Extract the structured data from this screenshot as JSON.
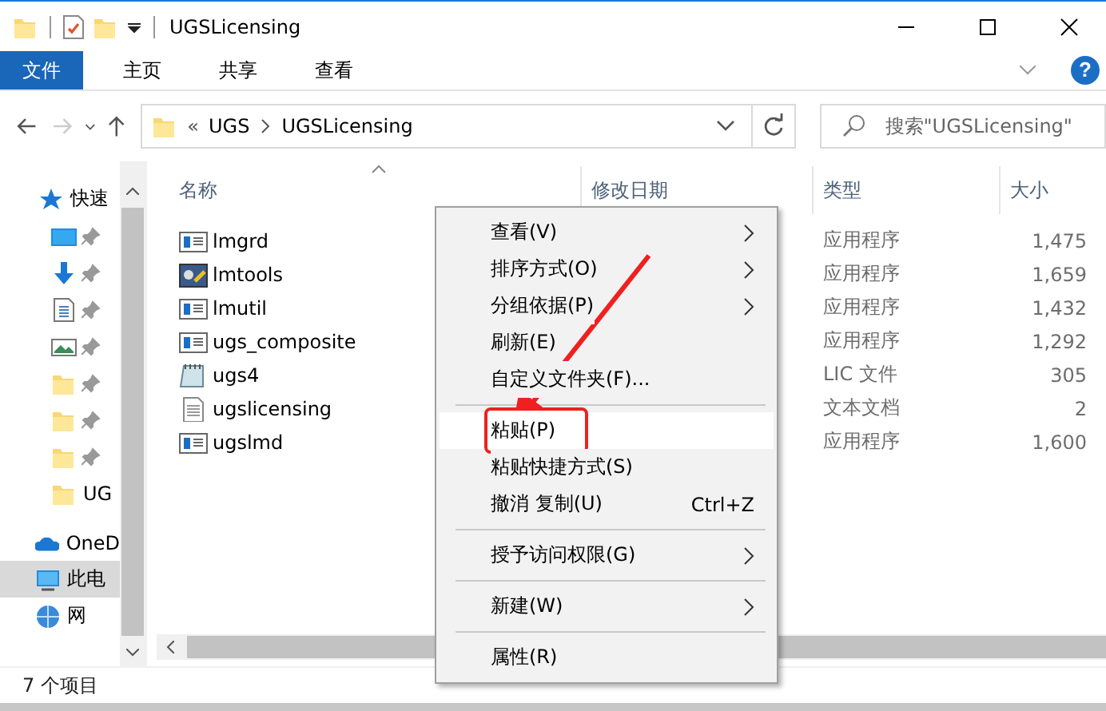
{
  "window": {
    "title": "UGSLicensing"
  },
  "ribbon": {
    "tabs": [
      {
        "label": "文件",
        "selected": true
      },
      {
        "label": "主页",
        "selected": false
      },
      {
        "label": "共享",
        "selected": false
      },
      {
        "label": "查看",
        "selected": false
      }
    ],
    "help": "?"
  },
  "address": {
    "overflow": "«",
    "path": [
      "UGS",
      "UGSLicensing"
    ],
    "search_placeholder": "搜索\"UGSLicensing\""
  },
  "sidebar": {
    "items": [
      {
        "label": "快速",
        "kind": "star",
        "selected": false
      },
      {
        "kind": "desktop",
        "pinned": true,
        "selected": false
      },
      {
        "kind": "download",
        "pinned": true,
        "selected": false
      },
      {
        "kind": "document",
        "pinned": true,
        "selected": false
      },
      {
        "kind": "image",
        "pinned": true,
        "selected": false
      },
      {
        "kind": "folder",
        "pinned": true,
        "selected": false
      },
      {
        "kind": "folder",
        "pinned": true,
        "selected": false
      },
      {
        "kind": "folder",
        "pinned": true,
        "selected": false
      },
      {
        "label": "UG",
        "kind": "folder",
        "pinned": false,
        "selected": false
      },
      {
        "label": "OneD",
        "kind": "cloud",
        "selected": false
      },
      {
        "label": "此电",
        "kind": "pc",
        "selected": true
      },
      {
        "label": "网",
        "kind": "network",
        "selected": false
      }
    ]
  },
  "table": {
    "columns": [
      "名称",
      "修改日期",
      "类型",
      "大小"
    ],
    "rows": [
      {
        "name": "lmgrd",
        "kind": "app",
        "type": "应用程序",
        "size": "1,475"
      },
      {
        "name": "lmtools",
        "kind": "tool",
        "type": "应用程序",
        "size": "1,659"
      },
      {
        "name": "lmutil",
        "kind": "app",
        "type": "应用程序",
        "size": "1,432"
      },
      {
        "name": "ugs_composite",
        "kind": "app",
        "type": "应用程序",
        "size": "1,292"
      },
      {
        "name": "ugs4",
        "kind": "notepad",
        "type": "LIC 文件",
        "size": "305"
      },
      {
        "name": "ugslicensing",
        "kind": "text",
        "type": "文本文档",
        "size": "2"
      },
      {
        "name": "ugslmd",
        "kind": "app",
        "type": "应用程序",
        "size": "1,600"
      }
    ]
  },
  "context_menu": {
    "items": [
      {
        "kind": "item",
        "label": "查看(V)",
        "submenu": true
      },
      {
        "kind": "item",
        "label": "排序方式(O)",
        "submenu": true
      },
      {
        "kind": "item",
        "label": "分组依据(P)",
        "submenu": true
      },
      {
        "kind": "item",
        "label": "刷新(E)"
      },
      {
        "kind": "item",
        "label": "自定义文件夹(F)..."
      },
      {
        "kind": "separator"
      },
      {
        "kind": "item",
        "label": "粘贴(P)",
        "highlighted": true,
        "annotated": true
      },
      {
        "kind": "item",
        "label": "粘贴快捷方式(S)"
      },
      {
        "kind": "item",
        "label": "撤消 复制(U)",
        "shortcut": "Ctrl+Z"
      },
      {
        "kind": "separator"
      },
      {
        "kind": "item",
        "label": "授予访问权限(G)",
        "submenu": true
      },
      {
        "kind": "separator"
      },
      {
        "kind": "item",
        "label": "新建(W)",
        "submenu": true
      },
      {
        "kind": "separator"
      },
      {
        "kind": "item",
        "label": "属性(R)"
      }
    ]
  },
  "status_bar": {
    "text": "7 个项目"
  }
}
